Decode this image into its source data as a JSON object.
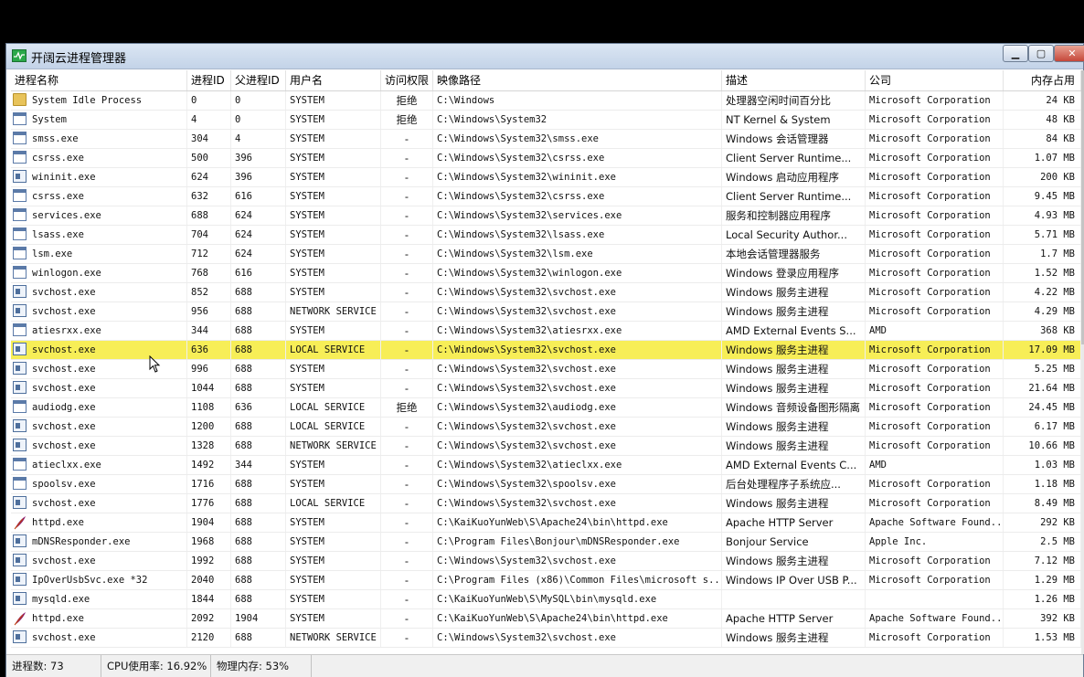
{
  "window": {
    "title": "开阔云进程管理器",
    "min_icon": "minimize-icon",
    "max_icon": "maximize-icon",
    "close_icon": "close-icon"
  },
  "columns": [
    "进程名称",
    "进程ID",
    "父进程ID",
    "用户名",
    "访问权限",
    "映像路径",
    "描述",
    "公司",
    "内存占用"
  ],
  "rows": [
    {
      "icon": "folder",
      "name": "System Idle Process",
      "pid": "0",
      "ppid": "0",
      "user": "SYSTEM",
      "access": "拒绝",
      "path": "C:\\Windows",
      "desc": "处理器空闲时间百分比",
      "company": "Microsoft Corporation",
      "mem": "24 KB"
    },
    {
      "icon": "window",
      "name": "System",
      "pid": "4",
      "ppid": "0",
      "user": "SYSTEM",
      "access": "拒绝",
      "path": "C:\\Windows\\System32",
      "desc": "NT Kernel & System",
      "company": "Microsoft Corporation",
      "mem": "48 KB"
    },
    {
      "icon": "window",
      "name": "smss.exe",
      "pid": "304",
      "ppid": "4",
      "user": "SYSTEM",
      "access": "-",
      "path": "C:\\Windows\\System32\\smss.exe",
      "desc": "Windows 会话管理器",
      "company": "Microsoft Corporation",
      "mem": "84 KB"
    },
    {
      "icon": "window",
      "name": "csrss.exe",
      "pid": "500",
      "ppid": "396",
      "user": "SYSTEM",
      "access": "-",
      "path": "C:\\Windows\\System32\\csrss.exe",
      "desc": "Client Server Runtime...",
      "company": "Microsoft Corporation",
      "mem": "1.07 MB"
    },
    {
      "icon": "app",
      "name": "wininit.exe",
      "pid": "624",
      "ppid": "396",
      "user": "SYSTEM",
      "access": "-",
      "path": "C:\\Windows\\System32\\wininit.exe",
      "desc": "Windows 启动应用程序",
      "company": "Microsoft Corporation",
      "mem": "200 KB"
    },
    {
      "icon": "window",
      "name": "csrss.exe",
      "pid": "632",
      "ppid": "616",
      "user": "SYSTEM",
      "access": "-",
      "path": "C:\\Windows\\System32\\csrss.exe",
      "desc": "Client Server Runtime...",
      "company": "Microsoft Corporation",
      "mem": "9.45 MB"
    },
    {
      "icon": "window",
      "name": "services.exe",
      "pid": "688",
      "ppid": "624",
      "user": "SYSTEM",
      "access": "-",
      "path": "C:\\Windows\\System32\\services.exe",
      "desc": "服务和控制器应用程序",
      "company": "Microsoft Corporation",
      "mem": "4.93 MB"
    },
    {
      "icon": "window",
      "name": "lsass.exe",
      "pid": "704",
      "ppid": "624",
      "user": "SYSTEM",
      "access": "-",
      "path": "C:\\Windows\\System32\\lsass.exe",
      "desc": "Local Security Author...",
      "company": "Microsoft Corporation",
      "mem": "5.71 MB"
    },
    {
      "icon": "window",
      "name": "lsm.exe",
      "pid": "712",
      "ppid": "624",
      "user": "SYSTEM",
      "access": "-",
      "path": "C:\\Windows\\System32\\lsm.exe",
      "desc": "本地会话管理器服务",
      "company": "Microsoft Corporation",
      "mem": "1.7 MB"
    },
    {
      "icon": "window",
      "name": "winlogon.exe",
      "pid": "768",
      "ppid": "616",
      "user": "SYSTEM",
      "access": "-",
      "path": "C:\\Windows\\System32\\winlogon.exe",
      "desc": "Windows 登录应用程序",
      "company": "Microsoft Corporation",
      "mem": "1.52 MB"
    },
    {
      "icon": "app",
      "name": "svchost.exe",
      "pid": "852",
      "ppid": "688",
      "user": "SYSTEM",
      "access": "-",
      "path": "C:\\Windows\\System32\\svchost.exe",
      "desc": "Windows 服务主进程",
      "company": "Microsoft Corporation",
      "mem": "4.22 MB"
    },
    {
      "icon": "app",
      "name": "svchost.exe",
      "pid": "956",
      "ppid": "688",
      "user": "NETWORK SERVICE",
      "access": "-",
      "path": "C:\\Windows\\System32\\svchost.exe",
      "desc": "Windows 服务主进程",
      "company": "Microsoft Corporation",
      "mem": "4.29 MB"
    },
    {
      "icon": "window",
      "name": "atiesrxx.exe",
      "pid": "344",
      "ppid": "688",
      "user": "SYSTEM",
      "access": "-",
      "path": "C:\\Windows\\System32\\atiesrxx.exe",
      "desc": "AMD External Events S...",
      "company": "AMD",
      "mem": "368 KB"
    },
    {
      "icon": "app",
      "name": "svchost.exe",
      "pid": "636",
      "ppid": "688",
      "user": "LOCAL SERVICE",
      "access": "-",
      "path": "C:\\Windows\\System32\\svchost.exe",
      "desc": "Windows 服务主进程",
      "company": "Microsoft Corporation",
      "mem": "17.09 MB",
      "selected": true
    },
    {
      "icon": "app",
      "name": "svchost.exe",
      "pid": "996",
      "ppid": "688",
      "user": "SYSTEM",
      "access": "-",
      "path": "C:\\Windows\\System32\\svchost.exe",
      "desc": "Windows 服务主进程",
      "company": "Microsoft Corporation",
      "mem": "5.25 MB"
    },
    {
      "icon": "app",
      "name": "svchost.exe",
      "pid": "1044",
      "ppid": "688",
      "user": "SYSTEM",
      "access": "-",
      "path": "C:\\Windows\\System32\\svchost.exe",
      "desc": "Windows 服务主进程",
      "company": "Microsoft Corporation",
      "mem": "21.64 MB"
    },
    {
      "icon": "window",
      "name": "audiodg.exe",
      "pid": "1108",
      "ppid": "636",
      "user": "LOCAL SERVICE",
      "access": "拒绝",
      "path": "C:\\Windows\\System32\\audiodg.exe",
      "desc": "Windows 音频设备图形隔离",
      "company": "Microsoft Corporation",
      "mem": "24.45 MB"
    },
    {
      "icon": "app",
      "name": "svchost.exe",
      "pid": "1200",
      "ppid": "688",
      "user": "LOCAL SERVICE",
      "access": "-",
      "path": "C:\\Windows\\System32\\svchost.exe",
      "desc": "Windows 服务主进程",
      "company": "Microsoft Corporation",
      "mem": "6.17 MB"
    },
    {
      "icon": "app",
      "name": "svchost.exe",
      "pid": "1328",
      "ppid": "688",
      "user": "NETWORK SERVICE",
      "access": "-",
      "path": "C:\\Windows\\System32\\svchost.exe",
      "desc": "Windows 服务主进程",
      "company": "Microsoft Corporation",
      "mem": "10.66 MB"
    },
    {
      "icon": "window",
      "name": "atieclxx.exe",
      "pid": "1492",
      "ppid": "344",
      "user": "SYSTEM",
      "access": "-",
      "path": "C:\\Windows\\System32\\atieclxx.exe",
      "desc": "AMD External Events C...",
      "company": "AMD",
      "mem": "1.03 MB"
    },
    {
      "icon": "window",
      "name": "spoolsv.exe",
      "pid": "1716",
      "ppid": "688",
      "user": "SYSTEM",
      "access": "-",
      "path": "C:\\Windows\\System32\\spoolsv.exe",
      "desc": "后台处理程序子系统应...",
      "company": "Microsoft Corporation",
      "mem": "1.18 MB"
    },
    {
      "icon": "app",
      "name": "svchost.exe",
      "pid": "1776",
      "ppid": "688",
      "user": "LOCAL SERVICE",
      "access": "-",
      "path": "C:\\Windows\\System32\\svchost.exe",
      "desc": "Windows 服务主进程",
      "company": "Microsoft Corporation",
      "mem": "8.49 MB"
    },
    {
      "icon": "feather",
      "name": "httpd.exe",
      "pid": "1904",
      "ppid": "688",
      "user": "SYSTEM",
      "access": "-",
      "path": "C:\\KaiKuoYunWeb\\S\\Apache24\\bin\\httpd.exe",
      "desc": "Apache HTTP Server",
      "company": "Apache Software Found...",
      "mem": "292 KB"
    },
    {
      "icon": "app",
      "name": "mDNSResponder.exe",
      "pid": "1968",
      "ppid": "688",
      "user": "SYSTEM",
      "access": "-",
      "path": "C:\\Program Files\\Bonjour\\mDNSResponder.exe",
      "desc": "Bonjour Service",
      "company": "Apple Inc.",
      "mem": "2.5 MB"
    },
    {
      "icon": "app",
      "name": "svchost.exe",
      "pid": "1992",
      "ppid": "688",
      "user": "SYSTEM",
      "access": "-",
      "path": "C:\\Windows\\System32\\svchost.exe",
      "desc": "Windows 服务主进程",
      "company": "Microsoft Corporation",
      "mem": "7.12 MB"
    },
    {
      "icon": "app",
      "name": "IpOverUsbSvc.exe *32",
      "pid": "2040",
      "ppid": "688",
      "user": "SYSTEM",
      "access": "-",
      "path": "C:\\Program Files (x86)\\Common Files\\microsoft s...",
      "desc": "Windows IP Over USB P...",
      "company": "Microsoft Corporation",
      "mem": "1.29 MB"
    },
    {
      "icon": "app",
      "name": "mysqld.exe",
      "pid": "1844",
      "ppid": "688",
      "user": "SYSTEM",
      "access": "-",
      "path": "C:\\KaiKuoYunWeb\\S\\MySQL\\bin\\mysqld.exe",
      "desc": "",
      "company": "",
      "mem": "1.26 MB"
    },
    {
      "icon": "feather",
      "name": "httpd.exe",
      "pid": "2092",
      "ppid": "1904",
      "user": "SYSTEM",
      "access": "-",
      "path": "C:\\KaiKuoYunWeb\\S\\Apache24\\bin\\httpd.exe",
      "desc": "Apache HTTP Server",
      "company": "Apache Software Found...",
      "mem": "392 KB"
    },
    {
      "icon": "app",
      "name": "svchost.exe",
      "pid": "2120",
      "ppid": "688",
      "user": "NETWORK SERVICE",
      "access": "-",
      "path": "C:\\Windows\\System32\\svchost.exe",
      "desc": "Windows 服务主进程",
      "company": "Microsoft Corporation",
      "mem": "1.53 MB"
    }
  ],
  "status": {
    "process_count": "进程数: 73",
    "cpu": "CPU使用率: 16.92%",
    "memory": "物理内存: 53%"
  },
  "colors": {
    "selected_row": "#f7ee57",
    "titlebar": "#c3d3e8"
  }
}
